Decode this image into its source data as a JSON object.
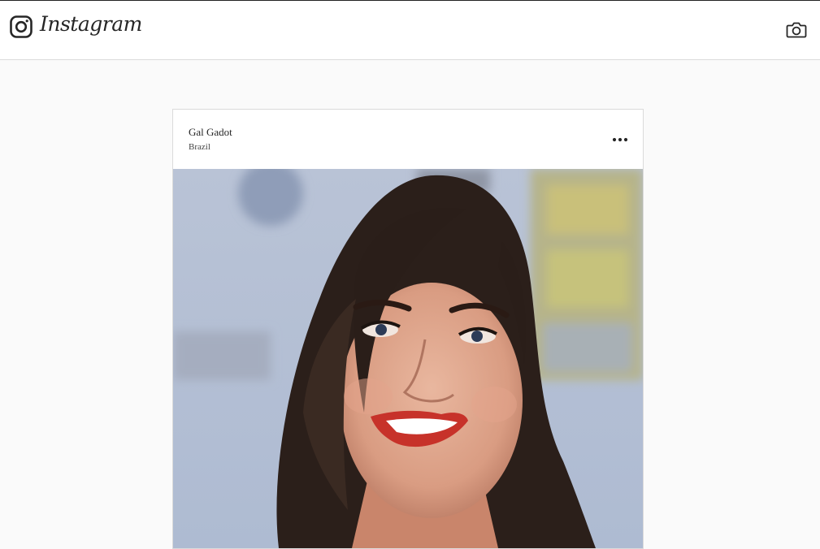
{
  "app": {
    "brand_name": "Instagram",
    "brand_icon": "instagram-logo-icon",
    "camera_icon": "camera-icon"
  },
  "post": {
    "username": "Gal Gadot",
    "location": "Brazil",
    "more_icon": "more-options-icon",
    "image_alt": "Portrait photo of a smiling woman with long dark hair"
  },
  "colors": {
    "page_bg": "#fafafa",
    "header_bg": "#ffffff",
    "border": "#dbdbdb",
    "text": "#262626"
  }
}
